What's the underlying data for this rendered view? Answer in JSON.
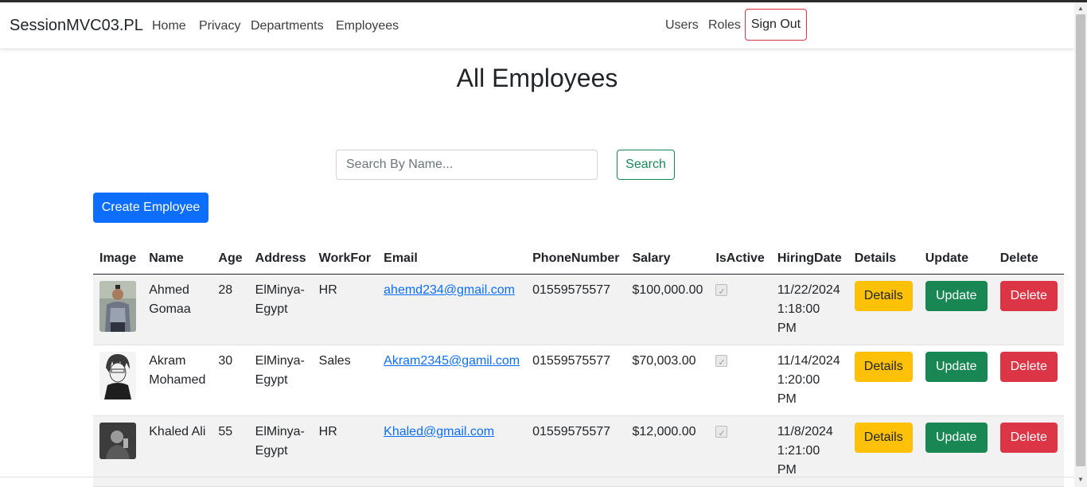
{
  "brand": "SessionMVC03.PL",
  "nav": {
    "home": "Home",
    "privacy": "Privacy",
    "departments": "Departments",
    "employees": "Employees",
    "users": "Users",
    "roles": "Roles",
    "sign_out": "Sign Out"
  },
  "page": {
    "title": "All Employees"
  },
  "search": {
    "placeholder": "Search By Name...",
    "value": "",
    "button": "Search"
  },
  "create_button": "Create Employee",
  "table": {
    "headers": [
      "Image",
      "Name",
      "Age",
      "Address",
      "WorkFor",
      "Email",
      "PhoneNumber",
      "Salary",
      "IsActive",
      "HiringDate",
      "Details",
      "Update",
      "Delete"
    ],
    "rows": [
      {
        "name": "Ahmed Gomaa",
        "age": "28",
        "address": "ElMinya-Egypt",
        "work_for": "HR",
        "email": "ahemd234@gmail.com",
        "phone": "01559575577",
        "salary": "$100,000.00",
        "is_active": true,
        "hiring_date": "11/22/2024 1:18:00 PM",
        "details": "Details",
        "update": "Update",
        "delete": "Delete"
      },
      {
        "name": "Akram Mohamed",
        "age": "30",
        "address": "ElMinya-Egypt",
        "work_for": "Sales",
        "email": "Akram2345@gamil.com",
        "phone": "01559575577",
        "salary": "$70,003.00",
        "is_active": true,
        "hiring_date": "11/14/2024 1:20:00 PM",
        "details": "Details",
        "update": "Update",
        "delete": "Delete"
      },
      {
        "name": "Khaled Ali",
        "age": "55",
        "address": "ElMinya-Egypt",
        "work_for": "HR",
        "email": "Khaled@gmail.com",
        "phone": "01559575577",
        "salary": "$12,000.00",
        "is_active": true,
        "hiring_date": "11/8/2024 1:21:00 PM",
        "details": "Details",
        "update": "Update",
        "delete": "Delete"
      }
    ]
  },
  "colors": {
    "primary": "#0d6efd",
    "success": "#198754",
    "warning": "#ffc107",
    "danger": "#dc3545"
  }
}
